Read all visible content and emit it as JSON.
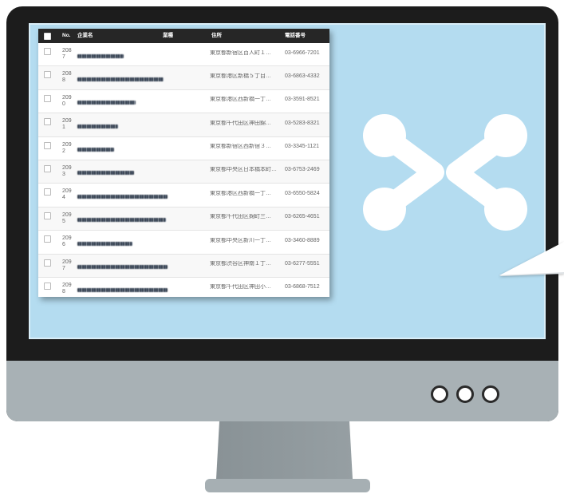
{
  "colors": {
    "bezel": "#1c1c1c",
    "screen": "#b4dcf0",
    "chin": "#a8b1b5",
    "stand": "#8f989c",
    "stand_base": "#a6afb3",
    "table_header": "#262626",
    "logo": "#ffffff"
  },
  "icons": {
    "logo": "brand-logo-icon",
    "checkbox": "checkbox-icon",
    "chin_buttons": "indicator-dot-icon",
    "callout": "callout-pointer-icon"
  },
  "table": {
    "columns": {
      "no": "No.",
      "company": "企業名",
      "industry": "業種",
      "address": "住所",
      "phone": "電話番号"
    },
    "rows": [
      {
        "no": "2087",
        "address": "東京都新宿区百人町１…",
        "phone": "03-6966-7201"
      },
      {
        "no": "2088",
        "address": "東京都港区新橋５丁目…",
        "phone": "03-6863-4332"
      },
      {
        "no": "2090",
        "address": "東京都港区西新橋一丁…",
        "phone": "03-3591-8521"
      },
      {
        "no": "2091",
        "address": "東京都千代田区神田錦…",
        "phone": "03-5283-8321"
      },
      {
        "no": "2092",
        "address": "東京都新宿区西新宿３…",
        "phone": "03-3345-1121"
      },
      {
        "no": "2093",
        "address": "東京都中央区日本橋本町…",
        "phone": "03-6753-2469"
      },
      {
        "no": "2094",
        "address": "東京都港区西新橋一丁…",
        "phone": "03-6550-5824"
      },
      {
        "no": "2095",
        "address": "東京都千代田区麹町三…",
        "phone": "03-6265-4651"
      },
      {
        "no": "2096",
        "address": "東京都中央区新川一丁…",
        "phone": "03-3460-8889"
      },
      {
        "no": "2097",
        "address": "東京都渋谷区神南１丁…",
        "phone": "03-6277-5551"
      },
      {
        "no": "2098",
        "address": "東京都千代田区神田小…",
        "phone": "03-6868-7512"
      }
    ]
  }
}
